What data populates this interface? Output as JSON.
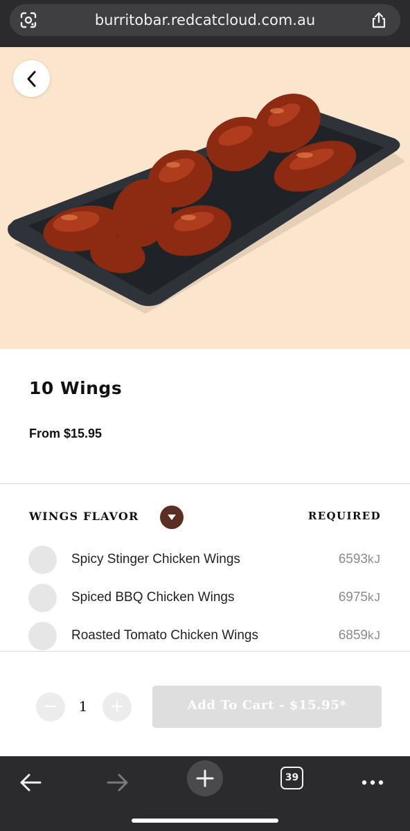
{
  "browser": {
    "url": "burritobar.redcatcloud.com.au",
    "tab_count": "39"
  },
  "product": {
    "title": "10 Wings",
    "price": "From $15.95",
    "image": "bbq-chicken-wings-photo"
  },
  "options_group": {
    "title": "WINGS FLAVOR",
    "required_label": "REQUIRED",
    "options": [
      {
        "label": "Spicy Stinger Chicken Wings",
        "kj": "6593",
        "unit": "kJ"
      },
      {
        "label": "Spiced BBQ Chicken Wings",
        "kj": "6975",
        "unit": "kJ"
      },
      {
        "label": "Roasted Tomato Chicken Wings",
        "kj": "6859",
        "unit": "kJ"
      }
    ]
  },
  "cart": {
    "quantity": "1",
    "minus": "−",
    "plus": "+",
    "add_label": "Add To Cart - $15.95*"
  },
  "colors": {
    "hero_bg": "#fbe5cc",
    "accent": "#5a2f22",
    "disabled_button": "#dedede",
    "browser_chrome": "#2b2b2d"
  }
}
